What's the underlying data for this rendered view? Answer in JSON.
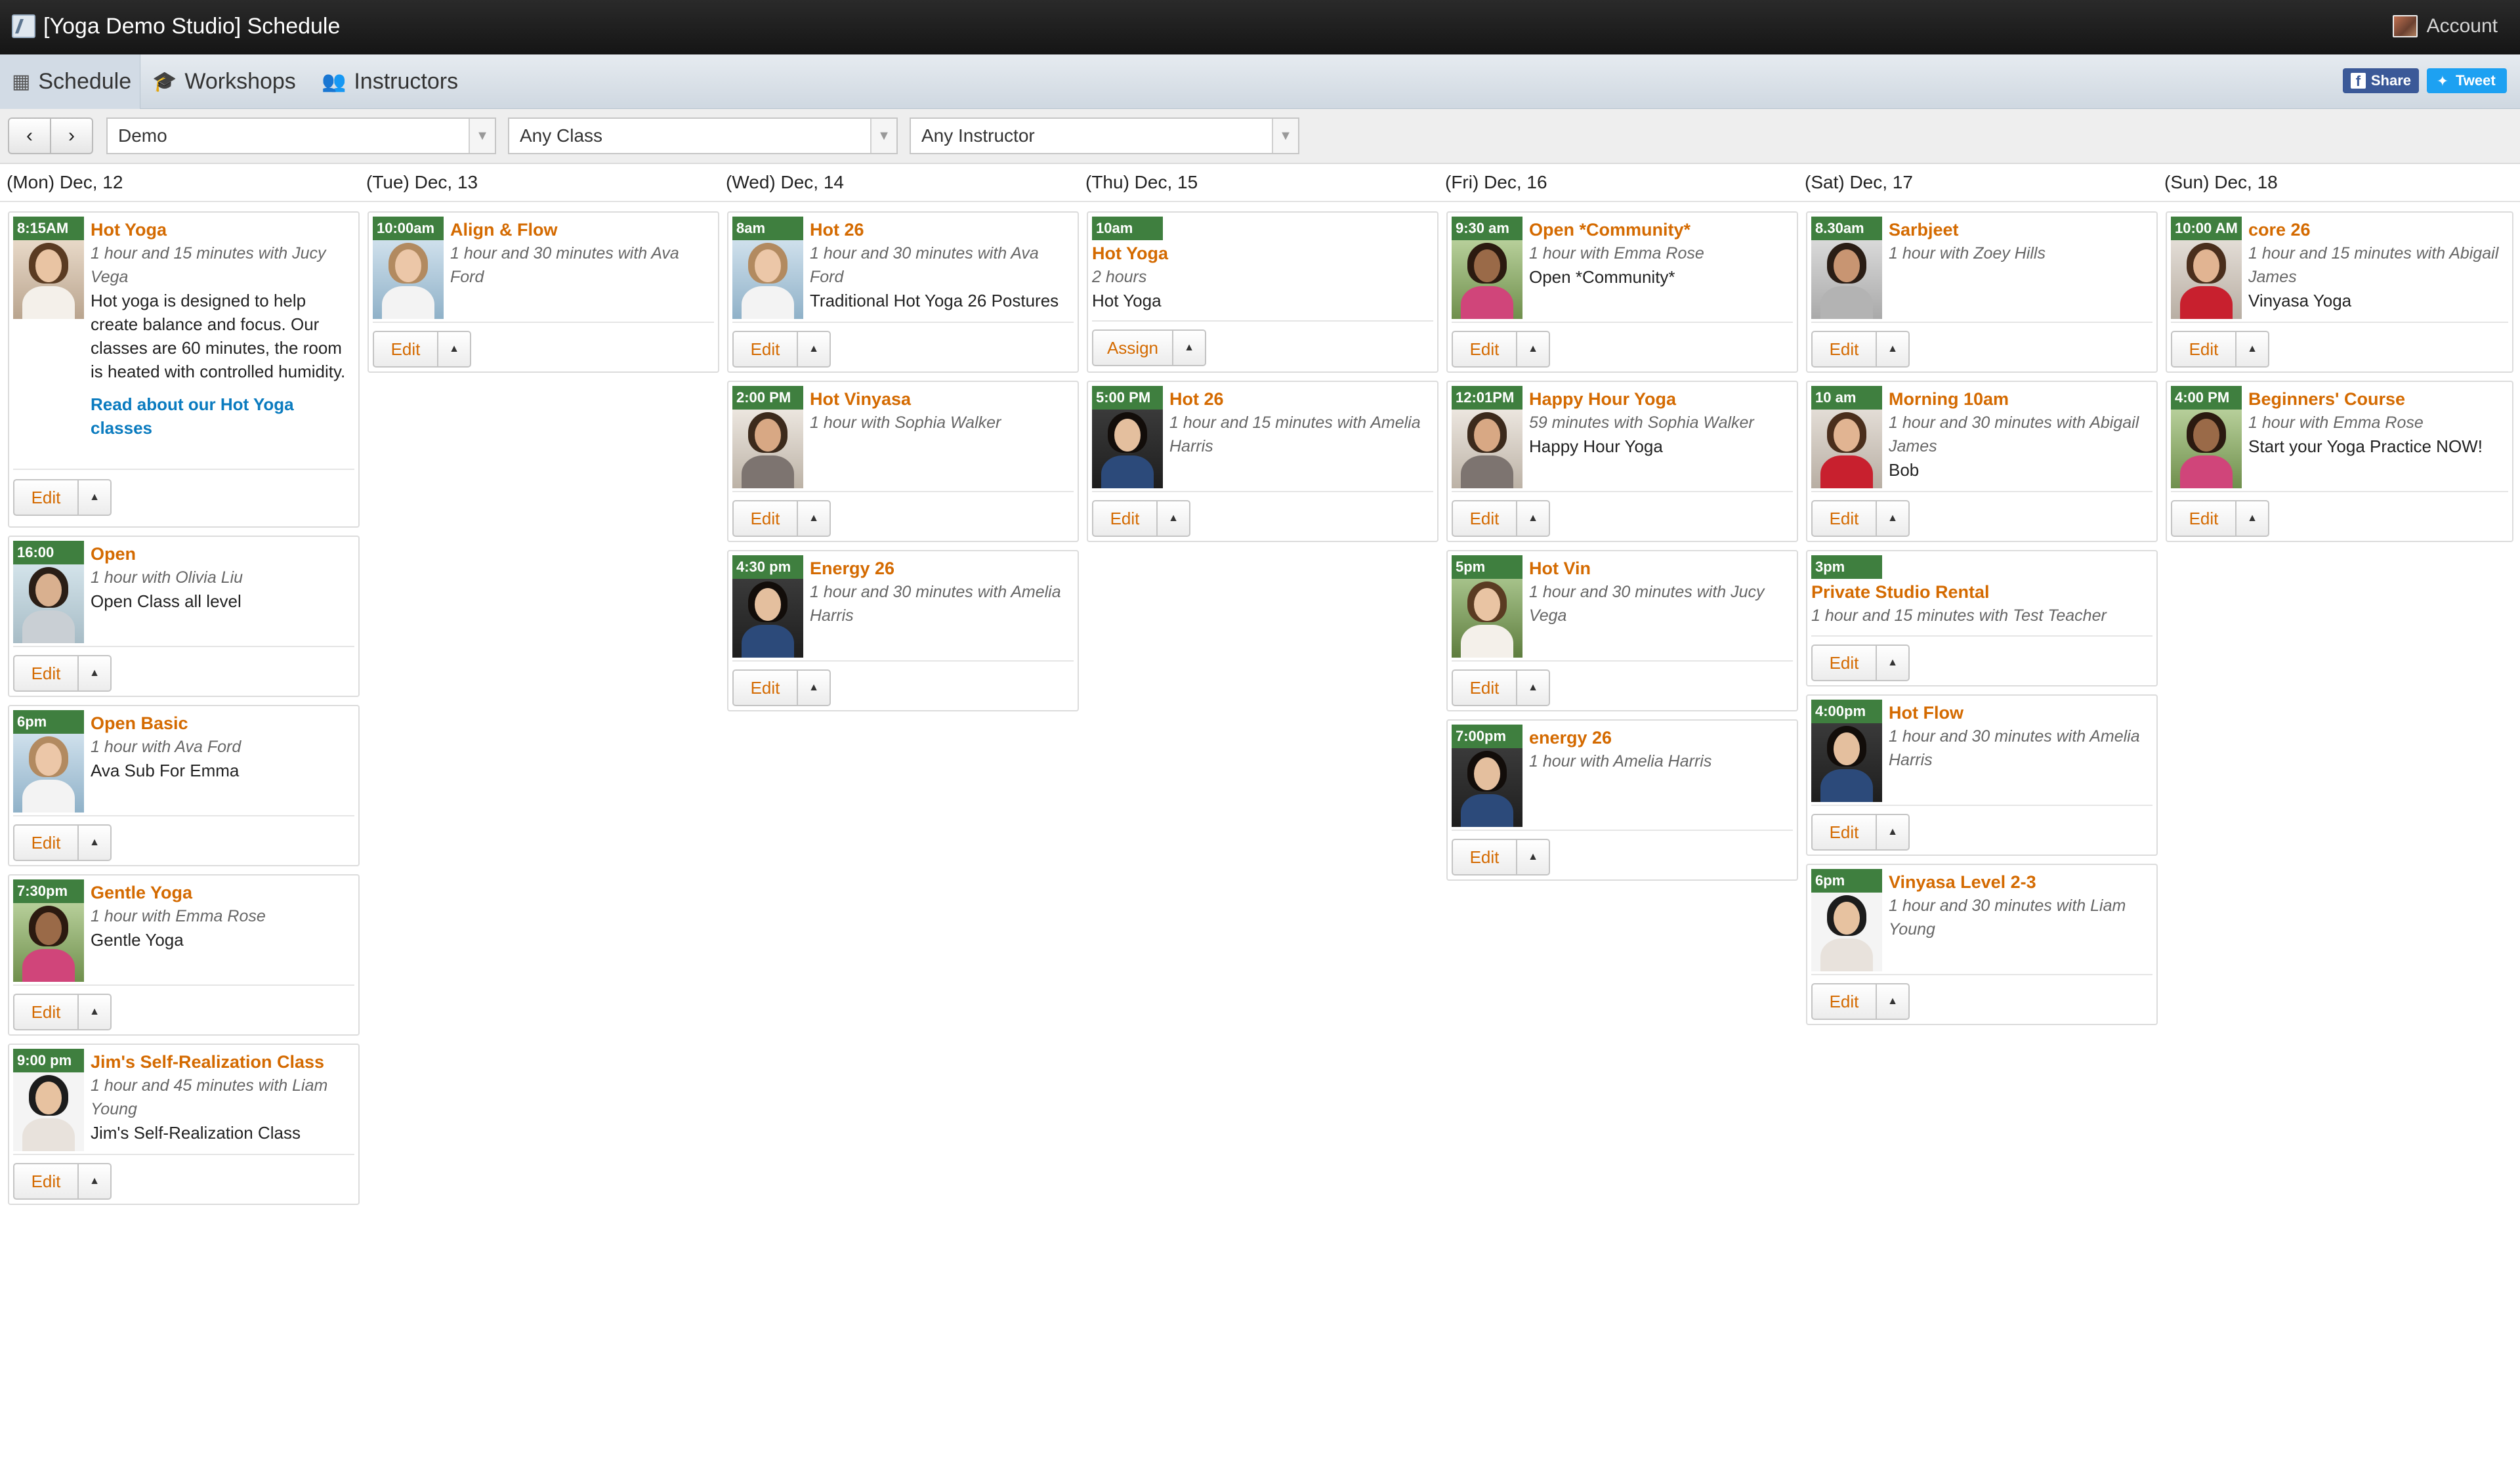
{
  "window": {
    "title": "[Yoga Demo Studio] Schedule",
    "account_label": "Account"
  },
  "tabs": [
    {
      "label": "Schedule",
      "icon": "calendar-icon",
      "active": true
    },
    {
      "label": "Workshops",
      "icon": "graduation-cap-icon",
      "active": false
    },
    {
      "label": "Instructors",
      "icon": "users-icon",
      "active": false
    }
  ],
  "social": {
    "share_label": "Share",
    "tweet_label": "Tweet"
  },
  "filters": {
    "prev_icon": "chevron-left-icon",
    "next_icon": "chevron-right-icon",
    "location": "Demo",
    "class": "Any Class",
    "instructor": "Any Instructor"
  },
  "days": [
    {
      "label": "(Mon) Dec, 12"
    },
    {
      "label": "(Tue) Dec, 13"
    },
    {
      "label": "(Wed) Dec, 14"
    },
    {
      "label": "(Thu) Dec, 15"
    },
    {
      "label": "(Fri) Dec, 16"
    },
    {
      "label": "(Sat) Dec, 17"
    },
    {
      "label": "(Sun) Dec, 18"
    }
  ],
  "buttons": {
    "edit": "Edit",
    "assign": "Assign",
    "caret": "▲"
  },
  "classes": {
    "mon": [
      {
        "time": "8:15AM",
        "name": "Hot Yoga",
        "duration": "1 hour and 15 minutes with Jucy Vega",
        "description": "Hot yoga is designed to help create balance and focus. Our classes are 60 minutes, the room is heated with controlled humidity.",
        "link": "Read about our Hot Yoga classes"
      },
      {
        "time": "16:00",
        "name": "Open",
        "duration": "1 hour with Olivia Liu",
        "description": "Open Class all level"
      },
      {
        "time": "6pm",
        "name": "Open Basic",
        "duration": "1 hour with Ava Ford",
        "description": "Ava Sub For Emma"
      },
      {
        "time": "7:30pm",
        "name": "Gentle Yoga",
        "duration": "1 hour with Emma Rose",
        "description": "Gentle Yoga"
      },
      {
        "time": "9:00 pm",
        "name": "Jim's Self-Realization Class",
        "duration": "1 hour and 45 minutes with Liam Young",
        "description": "Jim's Self-Realization Class"
      }
    ],
    "tue": [
      {
        "time": "10:00am",
        "name": "Align & Flow",
        "duration": "1 hour and 30 minutes with Ava Ford",
        "description": ""
      }
    ],
    "wed": [
      {
        "time": "8am",
        "name": "Hot 26",
        "duration": "1 hour and 30 minutes with Ava Ford",
        "description": "Traditional Hot Yoga 26 Postures"
      },
      {
        "time": "2:00 PM",
        "name": "Hot Vinyasa",
        "duration": "1 hour with Sophia Walker",
        "description": ""
      },
      {
        "time": "4:30 pm",
        "name": "Energy 26",
        "duration": "1 hour and 30 minutes with Amelia Harris",
        "description": ""
      }
    ],
    "thu": [
      {
        "time": "10am",
        "name": "Hot Yoga",
        "duration": "2 hours",
        "description": "Hot Yoga"
      },
      {
        "time": "5:00 PM",
        "name": "Hot 26",
        "duration": "1 hour and 15 minutes with Amelia Harris",
        "description": ""
      }
    ],
    "fri": [
      {
        "time": "9:30 am",
        "name": "Open *Community*",
        "duration": "1 hour with Emma Rose",
        "description": "Open *Community*"
      },
      {
        "time": "12:01PM",
        "name": "Happy Hour Yoga",
        "duration": "59 minutes with Sophia Walker",
        "description": "Happy Hour Yoga"
      },
      {
        "time": "5pm",
        "name": "Hot Vin",
        "duration": "1 hour and 30 minutes with Jucy Vega",
        "description": ""
      },
      {
        "time": "7:00pm",
        "name": "energy 26",
        "duration": "1 hour with Amelia Harris",
        "description": ""
      }
    ],
    "sat": [
      {
        "time": "8.30am",
        "name": "Sarbjeet",
        "duration": "1 hour with Zoey Hills",
        "description": ""
      },
      {
        "time": "10 am",
        "name": "Morning 10am",
        "duration": "1 hour and 30 minutes with Abigail James",
        "description": "Bob"
      },
      {
        "time": "3pm",
        "name": "Private Studio Rental",
        "duration": "1 hour and 15 minutes with Test Teacher",
        "description": ""
      },
      {
        "time": "4:00pm",
        "name": "Hot Flow",
        "duration": "1 hour and 30 minutes with Amelia Harris",
        "description": ""
      },
      {
        "time": "6pm",
        "name": "Vinyasa Level 2-3",
        "duration": "1 hour and 30 minutes with Liam Young",
        "description": ""
      }
    ],
    "sun": [
      {
        "time": "10:00 AM",
        "name": "core 26",
        "duration": "1 hour and 15 minutes with Abigail James",
        "description": "Vinyasa Yoga"
      },
      {
        "time": "4:00 PM",
        "name": "Beginners' Course",
        "duration": "1 hour with Emma Rose",
        "description": "Start your Yoga Practice NOW!"
      }
    ]
  },
  "colors": {
    "accent": "#d46a00",
    "badge": "#3f7f3f",
    "link": "#0a7bbf"
  }
}
